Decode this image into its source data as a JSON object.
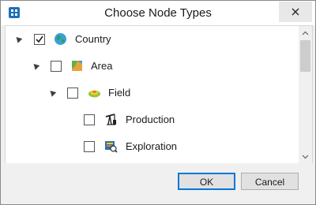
{
  "window": {
    "title": "Choose Node Types"
  },
  "tree": {
    "items": [
      {
        "label": "Country",
        "checked": true,
        "expanded": true,
        "icon": "globe-icon"
      },
      {
        "label": "Area",
        "checked": false,
        "expanded": true,
        "icon": "area-map-icon"
      },
      {
        "label": "Field",
        "checked": false,
        "expanded": true,
        "icon": "field-icon"
      },
      {
        "label": "Production",
        "checked": false,
        "icon": "oil-pump-icon"
      },
      {
        "label": "Exploration",
        "checked": false,
        "icon": "exploration-icon"
      }
    ]
  },
  "buttons": {
    "ok": "OK",
    "cancel": "Cancel"
  },
  "colors": {
    "accent": "#0078d7",
    "globe": "#2e9e5a",
    "field": "#8cc63f",
    "area": "#e8a23a"
  }
}
